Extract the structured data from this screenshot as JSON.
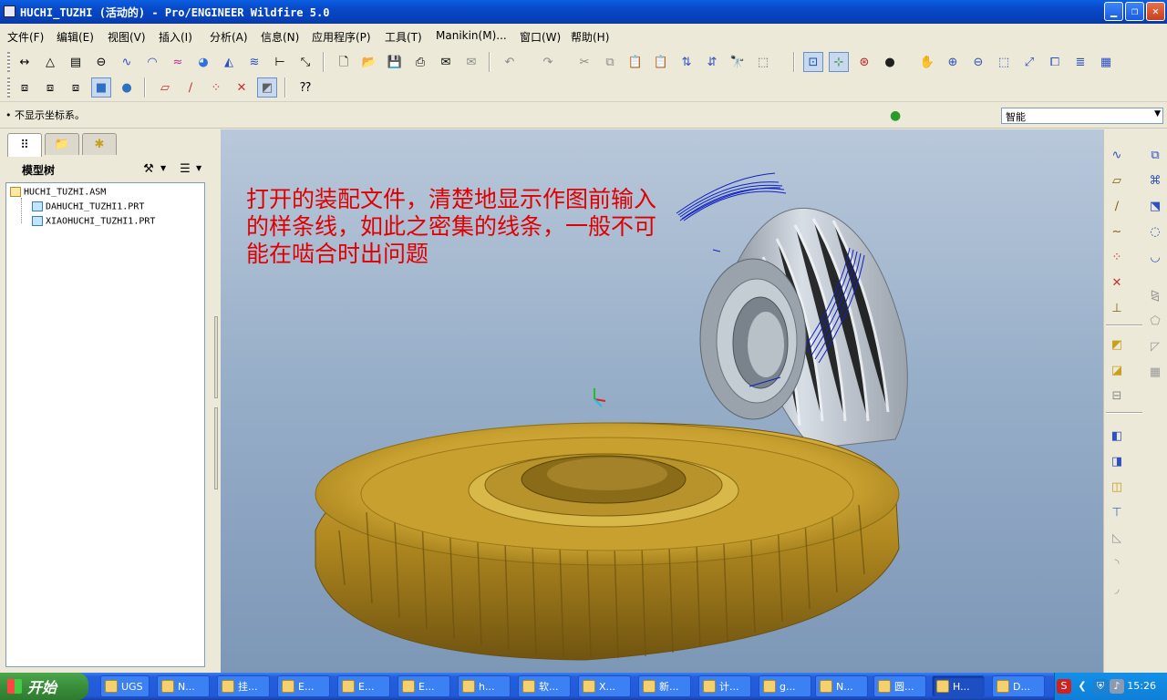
{
  "window": {
    "title": "HUCHI_TUZHI (活动的) - Pro/ENGINEER Wildfire 5.0"
  },
  "menu": {
    "items": [
      "文件(F)",
      "编辑(E)",
      "视图(V)",
      "插入(I)",
      "分析(A)",
      "信息(N)",
      "应用程序(P)",
      "工具(T)",
      "Manikin(M)...",
      "窗口(W)",
      "帮助(H)"
    ]
  },
  "status": {
    "message": "• 不显示坐标系。",
    "filter_value": "智能"
  },
  "model_tree": {
    "title": "模型树",
    "items": [
      {
        "label": "HUCHI_TUZHI.ASM",
        "type": "asm"
      },
      {
        "label": "DAHUCHI_TUZHI1.PRT",
        "type": "prt"
      },
      {
        "label": "XIAOHUCHI_TUZHI1.PRT",
        "type": "prt"
      }
    ]
  },
  "annotation": {
    "text": "打开的装配文件，清楚地显示作图前输入的样条线，如此之密集的线条，一般不可能在啮合时出问题"
  },
  "colors": {
    "gear_gold": "#c8a030",
    "pinion_silver": "#c4ccd4",
    "spline_blue": "#1020c0",
    "annotation_red": "#e00000"
  },
  "taskbar": {
    "start_label": "开始",
    "tasks": [
      "UGS",
      "N...",
      "挂...",
      "E...",
      "E...",
      "E...",
      "h...",
      "软...",
      "X...",
      "新...",
      "计...",
      "g...",
      "N...",
      "圆...",
      "H...",
      "D..."
    ],
    "clock": "15:26"
  }
}
